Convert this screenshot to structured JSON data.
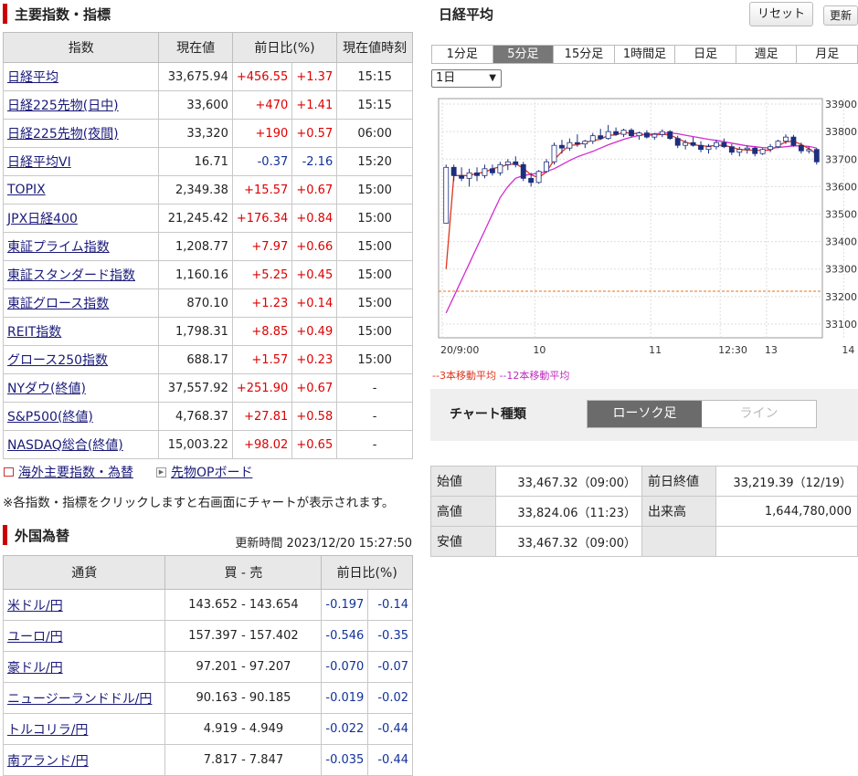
{
  "indices": {
    "title": "主要指数・指標",
    "headers": [
      "指数",
      "現在値",
      "前日比(%)",
      "現在値時刻"
    ],
    "rows": [
      {
        "name": "日経平均",
        "value": "33,675.94",
        "change": "+456.55",
        "pct": "+1.37",
        "time": "15:15",
        "dir": "up"
      },
      {
        "name": "日経225先物(日中)",
        "value": "33,600",
        "change": "+470",
        "pct": "+1.41",
        "time": "15:15",
        "dir": "up"
      },
      {
        "name": "日経225先物(夜間)",
        "value": "33,320",
        "change": "+190",
        "pct": "+0.57",
        "time": "06:00",
        "dir": "up"
      },
      {
        "name": "日経平均VI",
        "value": "16.71",
        "change": "-0.37",
        "pct": "-2.16",
        "time": "15:20",
        "dir": "dn"
      },
      {
        "name": "TOPIX",
        "value": "2,349.38",
        "change": "+15.57",
        "pct": "+0.67",
        "time": "15:00",
        "dir": "up"
      },
      {
        "name": "JPX日経400",
        "value": "21,245.42",
        "change": "+176.34",
        "pct": "+0.84",
        "time": "15:00",
        "dir": "up"
      },
      {
        "name": "東証プライム指数",
        "value": "1,208.77",
        "change": "+7.97",
        "pct": "+0.66",
        "time": "15:00",
        "dir": "up"
      },
      {
        "name": "東証スタンダード指数",
        "value": "1,160.16",
        "change": "+5.25",
        "pct": "+0.45",
        "time": "15:00",
        "dir": "up"
      },
      {
        "name": "東証グロース指数",
        "value": "870.10",
        "change": "+1.23",
        "pct": "+0.14",
        "time": "15:00",
        "dir": "up"
      },
      {
        "name": "REIT指数",
        "value": "1,798.31",
        "change": "+8.85",
        "pct": "+0.49",
        "time": "15:00",
        "dir": "up"
      },
      {
        "name": "グロース250指数",
        "value": "688.17",
        "change": "+1.57",
        "pct": "+0.23",
        "time": "15:00",
        "dir": "up"
      },
      {
        "name": "NYダウ(終値)",
        "value": "37,557.92",
        "change": "+251.90",
        "pct": "+0.67",
        "time": "-",
        "dir": "up"
      },
      {
        "name": "S&P500(終値)",
        "value": "4,768.37",
        "change": "+27.81",
        "pct": "+0.58",
        "time": "-",
        "dir": "up"
      },
      {
        "name": "NASDAQ総合(終値)",
        "value": "15,003.22",
        "change": "+98.02",
        "pct": "+0.65",
        "time": "-",
        "dir": "up"
      }
    ],
    "links": {
      "overseas": "海外主要指数・為替",
      "futures": "先物OPボード"
    },
    "note": "※各指数・指標をクリックしますと右画面にチャートが表示されます。"
  },
  "fx": {
    "title": "外国為替",
    "updated_label": "更新時間",
    "updated": "2023/12/20 15:27:50",
    "headers": [
      "通貨",
      "買 - 売",
      "前日比(%)"
    ],
    "rows": [
      {
        "name": "米ドル/円",
        "bidask": "143.652 - 143.654",
        "change": "-0.197",
        "pct": "-0.14"
      },
      {
        "name": "ユーロ/円",
        "bidask": "157.397 - 157.402",
        "change": "-0.546",
        "pct": "-0.35"
      },
      {
        "name": "豪ドル/円",
        "bidask": "97.201 - 97.207",
        "change": "-0.070",
        "pct": "-0.07"
      },
      {
        "name": "ニュージーランドドル/円",
        "bidask": "90.163 - 90.185",
        "change": "-0.019",
        "pct": "-0.02"
      },
      {
        "name": "トルコリラ/円",
        "bidask": "4.919 - 4.949",
        "change": "-0.022",
        "pct": "-0.44"
      },
      {
        "name": "南アランド/円",
        "bidask": "7.817 - 7.847",
        "change": "-0.035",
        "pct": "-0.44"
      }
    ]
  },
  "chart_panel": {
    "title": "日経平均",
    "reset_label": "リセット",
    "refresh_label": "更新",
    "tabs": [
      "1分足",
      "5分足",
      "15分足",
      "1時間足",
      "日足",
      "週足",
      "月足"
    ],
    "active_tab": 1,
    "period_select": "1日",
    "chart_type_label": "チャート種類",
    "chart_type_options": [
      "ローソク足",
      "ライン"
    ],
    "active_chart_type": 0
  },
  "chart_data": {
    "type": "candlestick",
    "y_ticks": [
      33100,
      33200,
      33300,
      33400,
      33500,
      33600,
      33700,
      33800,
      33900
    ],
    "ylim": [
      33050,
      33920
    ],
    "x_labels": [
      "20/9:00",
      "10",
      "11",
      "12:30",
      "13",
      "14"
    ],
    "prev_close": 33219.39,
    "legend": [
      "3本移動平均",
      "12本移動平均"
    ],
    "colors": {
      "up": "#ffffff",
      "down": "#1c2f7e",
      "ma3": "#e0341d",
      "ma12": "#d22bd0",
      "prev_close": "#e8701a"
    },
    "candles": [
      [
        33467,
        33680,
        33467,
        33670
      ],
      [
        33670,
        33680,
        33620,
        33640
      ],
      [
        33640,
        33670,
        33620,
        33630
      ],
      [
        33630,
        33665,
        33600,
        33650
      ],
      [
        33650,
        33670,
        33620,
        33640
      ],
      [
        33640,
        33680,
        33630,
        33665
      ],
      [
        33665,
        33680,
        33640,
        33650
      ],
      [
        33650,
        33690,
        33640,
        33680
      ],
      [
        33680,
        33700,
        33660,
        33690
      ],
      [
        33690,
        33710,
        33670,
        33680
      ],
      [
        33680,
        33690,
        33620,
        33630
      ],
      [
        33630,
        33650,
        33600,
        33615
      ],
      [
        33615,
        33660,
        33610,
        33655
      ],
      [
        33655,
        33700,
        33650,
        33690
      ],
      [
        33690,
        33760,
        33680,
        33750
      ],
      [
        33750,
        33770,
        33720,
        33740
      ],
      [
        33740,
        33775,
        33730,
        33760
      ],
      [
        33760,
        33790,
        33745,
        33755
      ],
      [
        33755,
        33770,
        33740,
        33765
      ],
      [
        33765,
        33795,
        33755,
        33785
      ],
      [
        33785,
        33810,
        33770,
        33775
      ],
      [
        33775,
        33824,
        33770,
        33800
      ],
      [
        33800,
        33815,
        33785,
        33790
      ],
      [
        33790,
        33810,
        33780,
        33805
      ],
      [
        33805,
        33812,
        33780,
        33785
      ],
      [
        33785,
        33800,
        33770,
        33795
      ],
      [
        33795,
        33805,
        33775,
        33780
      ],
      [
        33780,
        33795,
        33770,
        33790
      ],
      [
        33790,
        33808,
        33780,
        33800
      ],
      [
        33800,
        33805,
        33770,
        33775
      ],
      [
        33775,
        33785,
        33740,
        33750
      ],
      [
        33750,
        33770,
        33735,
        33760
      ],
      [
        33760,
        33780,
        33745,
        33750
      ],
      [
        33750,
        33765,
        33725,
        33735
      ],
      [
        33735,
        33755,
        33720,
        33745
      ],
      [
        33745,
        33770,
        33735,
        33760
      ],
      [
        33760,
        33775,
        33740,
        33745
      ],
      [
        33745,
        33755,
        33715,
        33725
      ],
      [
        33725,
        33745,
        33710,
        33735
      ],
      [
        33735,
        33750,
        33720,
        33740
      ],
      [
        33740,
        33745,
        33710,
        33720
      ],
      [
        33720,
        33740,
        33715,
        33735
      ],
      [
        33735,
        33755,
        33725,
        33745
      ],
      [
        33745,
        33770,
        33740,
        33765
      ],
      [
        33765,
        33790,
        33755,
        33780
      ],
      [
        33780,
        33788,
        33745,
        33750
      ],
      [
        33750,
        33760,
        33720,
        33730
      ],
      [
        33730,
        33745,
        33720,
        33735
      ],
      [
        33735,
        33740,
        33680,
        33690
      ]
    ],
    "ma3": [
      33300,
      33640,
      33640,
      33640,
      33648,
      33652,
      33665,
      33672,
      33680,
      33683,
      33667,
      33642,
      33633,
      33653,
      33698,
      33727,
      33750,
      33752,
      33760,
      33768,
      33772,
      33787,
      33788,
      33798,
      33793,
      33793,
      33787,
      33788,
      33790,
      33788,
      33775,
      33762,
      33753,
      33748,
      33747,
      33750,
      33750,
      33743,
      33735,
      33733,
      33732,
      33732,
      33733,
      33748,
      33763,
      33765,
      33753,
      33738,
      33718
    ],
    "ma12": [
      33140,
      33200,
      33260,
      33320,
      33380,
      33440,
      33500,
      33560,
      33600,
      33630,
      33640,
      33645,
      33648,
      33655,
      33665,
      33680,
      33695,
      33708,
      33718,
      33728,
      33740,
      33752,
      33762,
      33772,
      33780,
      33786,
      33790,
      33792,
      33794,
      33795,
      33792,
      33787,
      33782,
      33777,
      33772,
      33768,
      33763,
      33758,
      33753,
      33748,
      33745,
      33742,
      33740,
      33742,
      33745,
      33748,
      33748,
      33746,
      33740
    ]
  }
}
